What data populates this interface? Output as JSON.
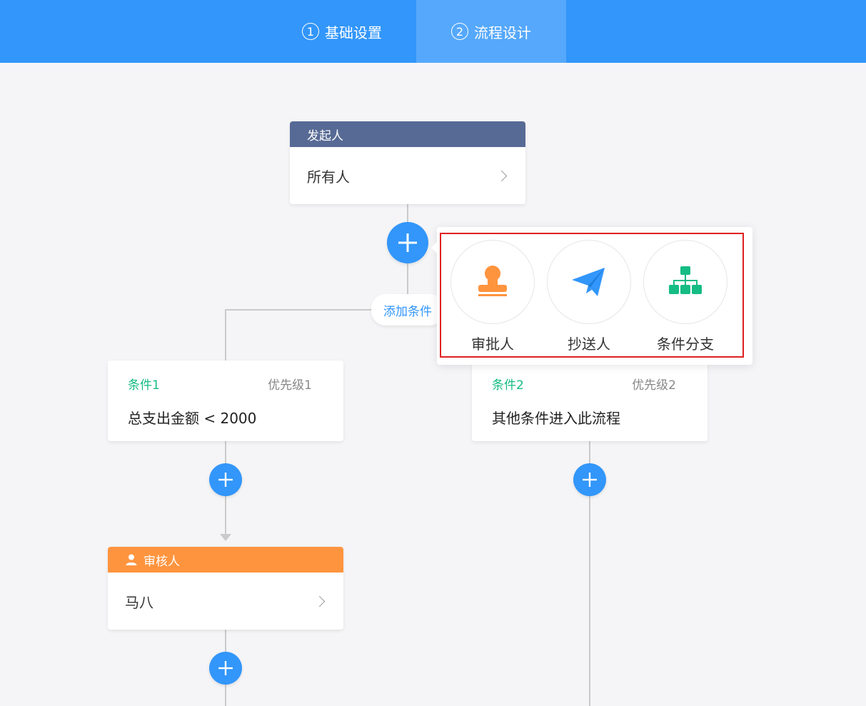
{
  "header": {
    "steps": [
      {
        "num": "1",
        "label": "基础设置"
      },
      {
        "num": "2",
        "label": "流程设计"
      }
    ]
  },
  "start_node": {
    "title": "发起人",
    "value": "所有人",
    "color": "#576a95"
  },
  "add_condition_label": "添加条件",
  "popover": {
    "options": [
      {
        "label": "审批人",
        "icon": "approver-stamp-icon",
        "color": "#ff943e"
      },
      {
        "label": "抄送人",
        "icon": "paper-plane-icon",
        "color": "#3296fa"
      },
      {
        "label": "条件分支",
        "icon": "org-branch-icon",
        "color": "#15bc83"
      }
    ]
  },
  "conditions": [
    {
      "name": "条件1",
      "priority": "优先级1",
      "desc": "总支出金额 < 2000"
    },
    {
      "name": "条件2",
      "priority": "优先级2",
      "desc": "其他条件进入此流程"
    }
  ],
  "approver_node": {
    "title": "审核人",
    "value": "马八",
    "color": "#ff943e"
  },
  "colors": {
    "accent": "#3296fa",
    "condition_green": "#15bc83",
    "highlight_red": "#e02020"
  }
}
